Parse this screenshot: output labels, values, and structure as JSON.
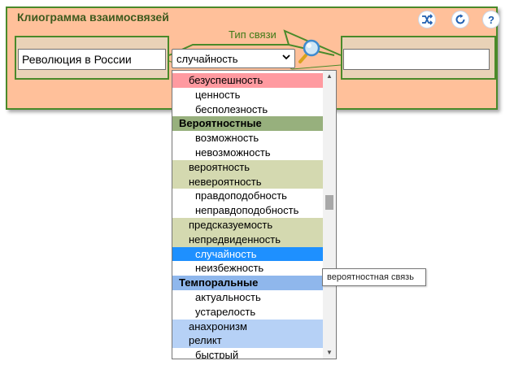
{
  "panel": {
    "title": "Клиограмма взаимосвязей",
    "connection_label": "Тип связи",
    "left_input_value": "Революция в России",
    "right_input_value": "",
    "select_value": "случайность",
    "icons": [
      "shuffle-icon",
      "refresh-icon",
      "help-icon"
    ],
    "help_glyph": "?"
  },
  "dropdown": {
    "items": [
      {
        "label": "безуспешность",
        "kind": "sub",
        "bg": "#ff9aa0"
      },
      {
        "label": "ценность",
        "kind": "item",
        "bg": "#ffffff"
      },
      {
        "label": "бесполезность",
        "kind": "item",
        "bg": "#ffffff"
      },
      {
        "label": "Вероятностные",
        "kind": "grp",
        "bg": "#97b07d"
      },
      {
        "label": "возможность",
        "kind": "item",
        "bg": "#ffffff"
      },
      {
        "label": "невозможность",
        "kind": "item",
        "bg": "#ffffff"
      },
      {
        "label": "вероятность",
        "kind": "sub",
        "bg": "#d4d9b0"
      },
      {
        "label": "невероятность",
        "kind": "sub",
        "bg": "#d4d9b0"
      },
      {
        "label": "правдоподобность",
        "kind": "item",
        "bg": "#ffffff"
      },
      {
        "label": "неправдоподобность",
        "kind": "item",
        "bg": "#ffffff"
      },
      {
        "label": "предсказуемость",
        "kind": "sub",
        "bg": "#d4d9b0"
      },
      {
        "label": "непредвиденность",
        "kind": "sub",
        "bg": "#d4d9b0"
      },
      {
        "label": "случайность",
        "kind": "sel",
        "bg": "#1e90ff"
      },
      {
        "label": "неизбежность",
        "kind": "item",
        "bg": "#ffffff"
      },
      {
        "label": "Темпоральные",
        "kind": "grp",
        "bg": "#8fb7ec"
      },
      {
        "label": "актуальность",
        "kind": "item",
        "bg": "#ffffff"
      },
      {
        "label": "устарелость",
        "kind": "item",
        "bg": "#ffffff"
      },
      {
        "label": "анахронизм",
        "kind": "sub",
        "bg": "#b6d1f6"
      },
      {
        "label": "реликт",
        "kind": "sub",
        "bg": "#b6d1f6"
      },
      {
        "label": "быстрый",
        "kind": "item",
        "bg": "#ffffff"
      }
    ]
  },
  "tooltip": {
    "text": "вероятностная связь"
  }
}
